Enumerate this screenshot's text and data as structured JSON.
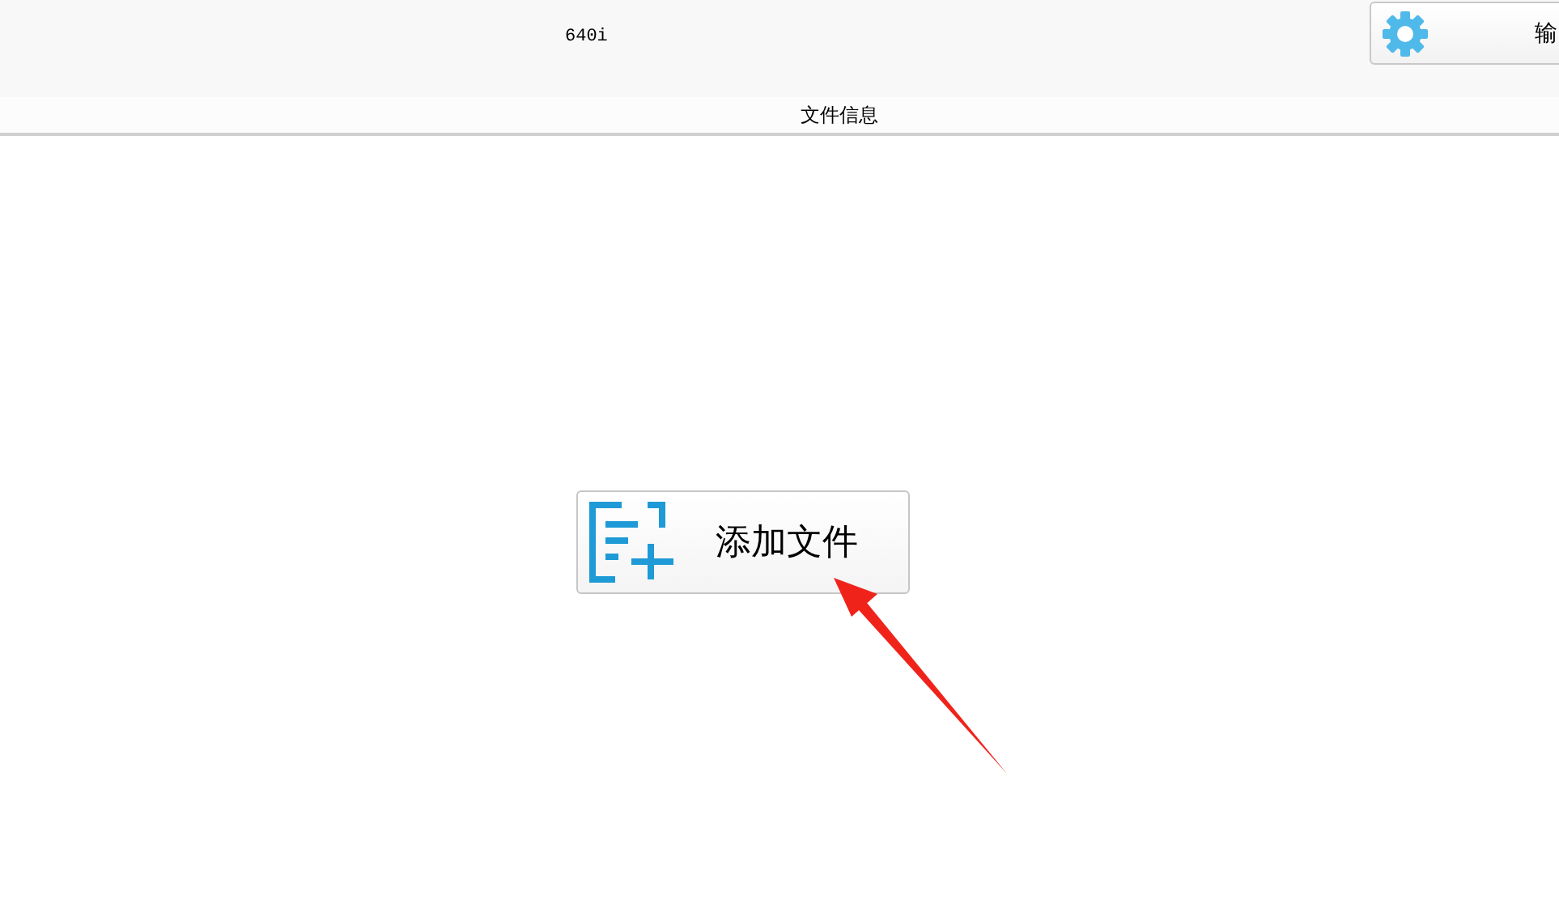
{
  "toolbar": {
    "label": "640i",
    "settings_button": {
      "label": "输"
    }
  },
  "header": {
    "title": "文件信息"
  },
  "add_file_button": {
    "label": "添加文件"
  },
  "annotation": {
    "kind": "arrow"
  }
}
